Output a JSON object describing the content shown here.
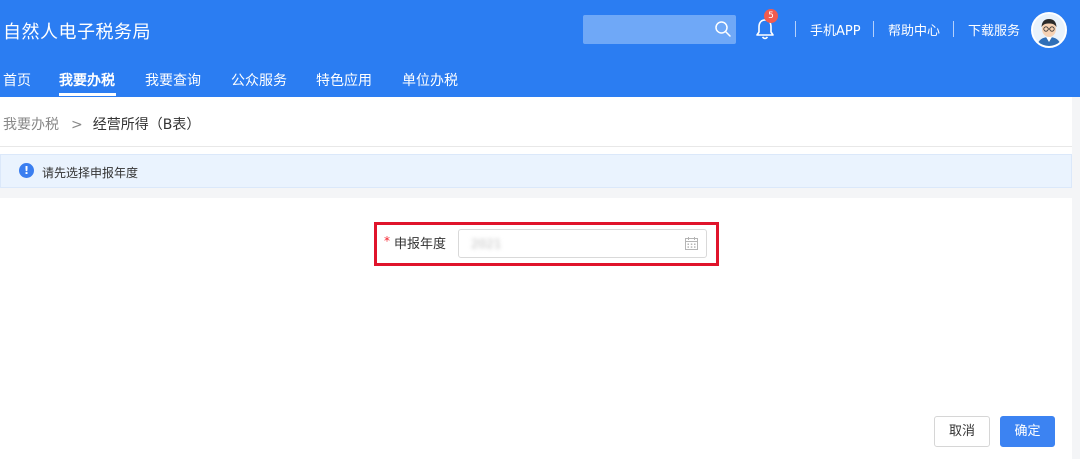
{
  "header": {
    "app_title": "自然人电子税务局",
    "notification_count": "5",
    "links": {
      "mobile_app": "手机APP",
      "help_center": "帮助中心",
      "download_service": "下载服务"
    }
  },
  "nav": {
    "items": [
      {
        "label": "首页"
      },
      {
        "label": "我要办税"
      },
      {
        "label": "我要查询"
      },
      {
        "label": "公众服务"
      },
      {
        "label": "特色应用"
      },
      {
        "label": "单位办税"
      }
    ],
    "active": "我要办税"
  },
  "breadcrumb": {
    "parent": "我要办税",
    "separator": ">",
    "current": "经营所得（B表）"
  },
  "notice": {
    "icon": "!",
    "text": "请先选择申报年度"
  },
  "form": {
    "required_mark": "*",
    "year_label": "申报年度",
    "year_value": "2021"
  },
  "buttons": {
    "cancel": "取消",
    "confirm": "确定"
  },
  "colors": {
    "header_bg": "#2b7df2",
    "highlight": "#e0142b",
    "primary_button": "#3c83f2",
    "badge": "#f25b4f"
  }
}
